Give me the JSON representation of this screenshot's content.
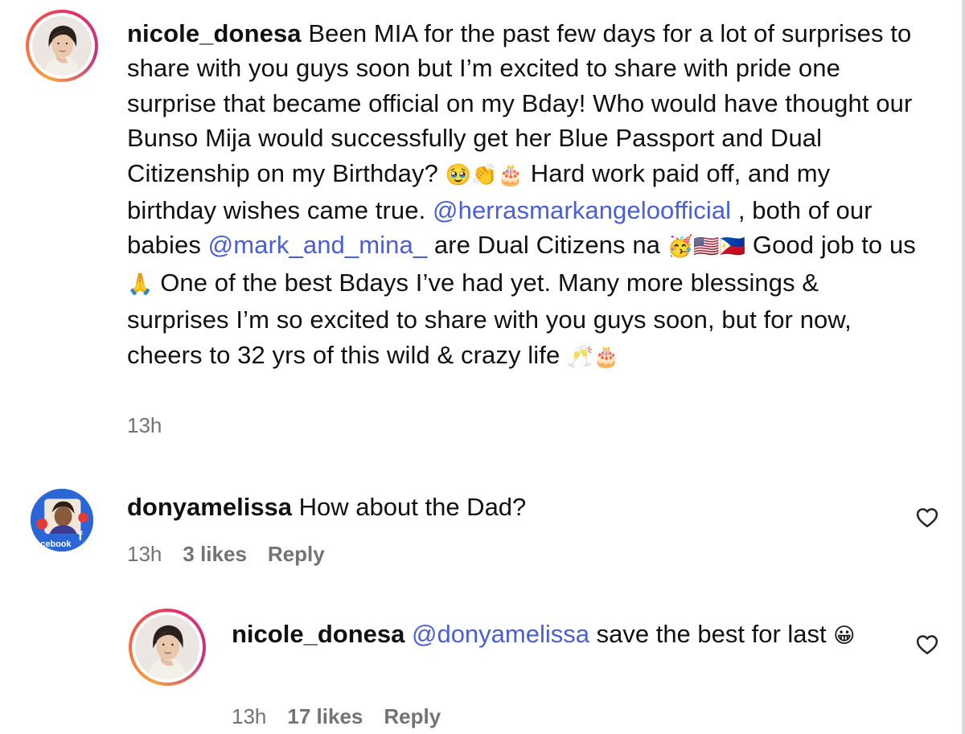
{
  "post": {
    "username": "nicole_donesa",
    "caption_parts": {
      "p1": " Been MIA for the past few days for a lot of surprises to share with you guys soon but I’m excited to share with pride one surprise that became official on my Bday! Who would have thought our Bunso Mija would successfully get her Blue Passport and Dual Citizenship on my Birthday? ",
      "e1": "🥹👏🎂",
      "p2": " Hard work paid off, and my birthday wishes came true. ",
      "mention1": "@herrasmarkangeloofficial",
      "p3": " , both of our babies ",
      "mention2": "@mark_and_mina_",
      "p4": " are Dual Citizens na ",
      "e2": "🥳🇺🇸🇵🇭",
      "p5": " Good job to us ",
      "e3": "🙏",
      "p6": " One of the best Bdays I’ve had yet. Many more blessings & surprises I’m so excited to share with you guys soon, but for now, cheers to 32 yrs of this wild & crazy life ",
      "e4": "🥂🎂"
    },
    "time": "13h",
    "avatar_icon": "profile-photo"
  },
  "comment1": {
    "username": "donyamelissa",
    "text": " How about the Dad?",
    "time": "13h",
    "likes": "3 likes",
    "reply_label": "Reply",
    "like_icon": "heart-outline-icon",
    "avatar_text": "acebook"
  },
  "reply1": {
    "username": "nicole_donesa",
    "mention": "@donyamelissa",
    "text": " save the best for last ",
    "emoji": "😀",
    "time": "13h",
    "likes": "17 likes",
    "reply_label": "Reply",
    "like_icon": "heart-outline-icon"
  },
  "colors": {
    "mention": "#4a5fd6",
    "meta": "#737373",
    "text": "#111111"
  }
}
